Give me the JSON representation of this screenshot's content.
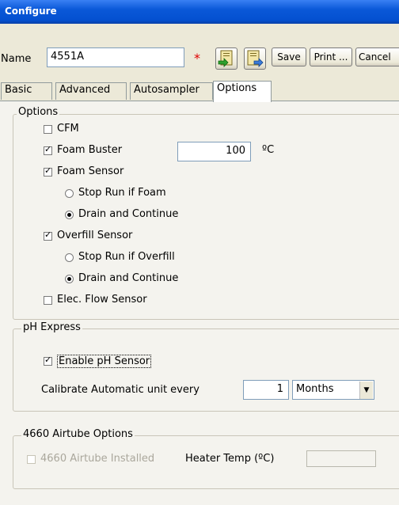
{
  "window": {
    "title": "Configure"
  },
  "toolbar": {
    "name_label": "Name",
    "name_value": "4551A",
    "required_marker": "*",
    "icon1": "import-document-icon",
    "icon2": "export-document-icon",
    "save_label": "Save",
    "print_label": "Print ...",
    "cancel_label": "Cancel"
  },
  "tabs": [
    {
      "label": "Basic",
      "active": false
    },
    {
      "label": "Advanced",
      "active": false
    },
    {
      "label": "Autosampler",
      "active": false
    },
    {
      "label": "Options",
      "active": true
    }
  ],
  "options": {
    "legend": "Options",
    "cfm": {
      "label": "CFM",
      "checked": false
    },
    "foam_buster": {
      "label": "Foam Buster",
      "checked": true,
      "value": "100",
      "unit": "ºC"
    },
    "foam_sensor": {
      "label": "Foam Sensor",
      "checked": true,
      "radios": [
        {
          "label": "Stop Run if Foam",
          "selected": false
        },
        {
          "label": "Drain and Continue",
          "selected": true
        }
      ]
    },
    "overfill_sensor": {
      "label": "Overfill Sensor",
      "checked": true,
      "radios": [
        {
          "label": "Stop Run if Overfill",
          "selected": false
        },
        {
          "label": "Drain and Continue",
          "selected": true
        }
      ]
    },
    "elec_flow": {
      "label": "Elec. Flow Sensor",
      "checked": false
    }
  },
  "ph_express": {
    "legend": "pH Express",
    "enable": {
      "label": "Enable pH Sensor",
      "checked": true
    },
    "calibrate_label": "Calibrate Automatic unit every",
    "calibrate_value": "1",
    "calibrate_unit": "Months"
  },
  "airtube": {
    "legend": "4660 Airtube Options",
    "installed": {
      "label": "4660 Airtube Installed",
      "checked": false,
      "disabled": true
    },
    "heater_label": "Heater Temp (ºC)",
    "heater_value": ""
  }
}
